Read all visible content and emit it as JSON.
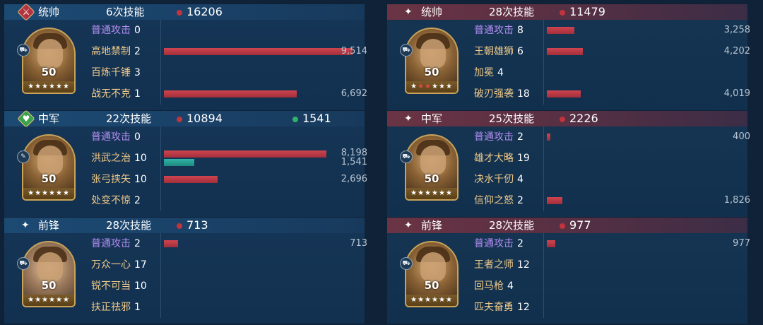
{
  "colors": {
    "damage_dot": "#c0343d",
    "heal_dot": "#2fb36a",
    "damage_bar": "#cf4450",
    "heal_bar": "#2fb3a6",
    "basic_attack_text": "#b48df2",
    "skill_text": "#f0c987"
  },
  "bar_scale_max": 11479,
  "left": [
    {
      "role": "统帅",
      "emblem": "red-sword-emblem",
      "skills": "6次技能",
      "damage": "16206",
      "heal": null,
      "level": "50",
      "red_stars": 0,
      "rows": [
        {
          "name": "普通攻击",
          "count": "0",
          "basic": true
        },
        {
          "name": "高地禁制",
          "count": "2",
          "damage": "9,514"
        },
        {
          "name": "百炼千锤",
          "count": "3"
        },
        {
          "name": "战无不克",
          "count": "1",
          "damage": "6,692"
        }
      ]
    },
    {
      "role": "中军",
      "emblem": "green-heart-emblem",
      "skills": "22次技能",
      "damage": "10894",
      "heal": "1541",
      "level": "50",
      "red_stars": 0,
      "rows": [
        {
          "name": "普通攻击",
          "count": "0",
          "basic": true
        },
        {
          "name": "洪武之治",
          "count": "10",
          "damage": "8,198",
          "heal": "1,541"
        },
        {
          "name": "张弓挟矢",
          "count": "10",
          "damage": "2,696"
        },
        {
          "name": "处变不惊",
          "count": "2"
        }
      ]
    },
    {
      "role": "前锋",
      "emblem": "star",
      "skills": "28次技能",
      "damage": "713",
      "heal": null,
      "level": "50",
      "red_stars": 0,
      "rows": [
        {
          "name": "普通攻击",
          "count": "2",
          "basic": true,
          "damage": "713"
        },
        {
          "name": "万众一心",
          "count": "17"
        },
        {
          "name": "锐不可当",
          "count": "10"
        },
        {
          "name": "扶正祛邪",
          "count": "1"
        }
      ]
    }
  ],
  "right": [
    {
      "role": "统帅",
      "emblem": "star",
      "skills": "28次技能",
      "damage": "11479",
      "heal": null,
      "level": "50",
      "red_stars": 2,
      "rows": [
        {
          "name": "普通攻击",
          "count": "8",
          "basic": true,
          "damage": "3,258"
        },
        {
          "name": "王朝雄狮",
          "count": "6",
          "damage": "4,202"
        },
        {
          "name": "加冕",
          "count": "4"
        },
        {
          "name": "破刃强袭",
          "count": "18",
          "damage": "4,019"
        }
      ]
    },
    {
      "role": "中军",
      "emblem": "star",
      "skills": "25次技能",
      "damage": "2226",
      "heal": null,
      "level": "50",
      "red_stars": 0,
      "rows": [
        {
          "name": "普通攻击",
          "count": "2",
          "basic": true,
          "damage": "400"
        },
        {
          "name": "雄才大略",
          "count": "19"
        },
        {
          "name": "决水千仞",
          "count": "4"
        },
        {
          "name": "信仰之怒",
          "count": "2",
          "damage": "1,826"
        }
      ]
    },
    {
      "role": "前锋",
      "emblem": "star",
      "skills": "28次技能",
      "damage": "977",
      "heal": null,
      "level": "50",
      "red_stars": 0,
      "rows": [
        {
          "name": "普通攻击",
          "count": "2",
          "basic": true,
          "damage": "977"
        },
        {
          "name": "王者之师",
          "count": "12"
        },
        {
          "name": "回马枪",
          "count": "4"
        },
        {
          "name": "匹夫奋勇",
          "count": "12"
        }
      ]
    }
  ]
}
